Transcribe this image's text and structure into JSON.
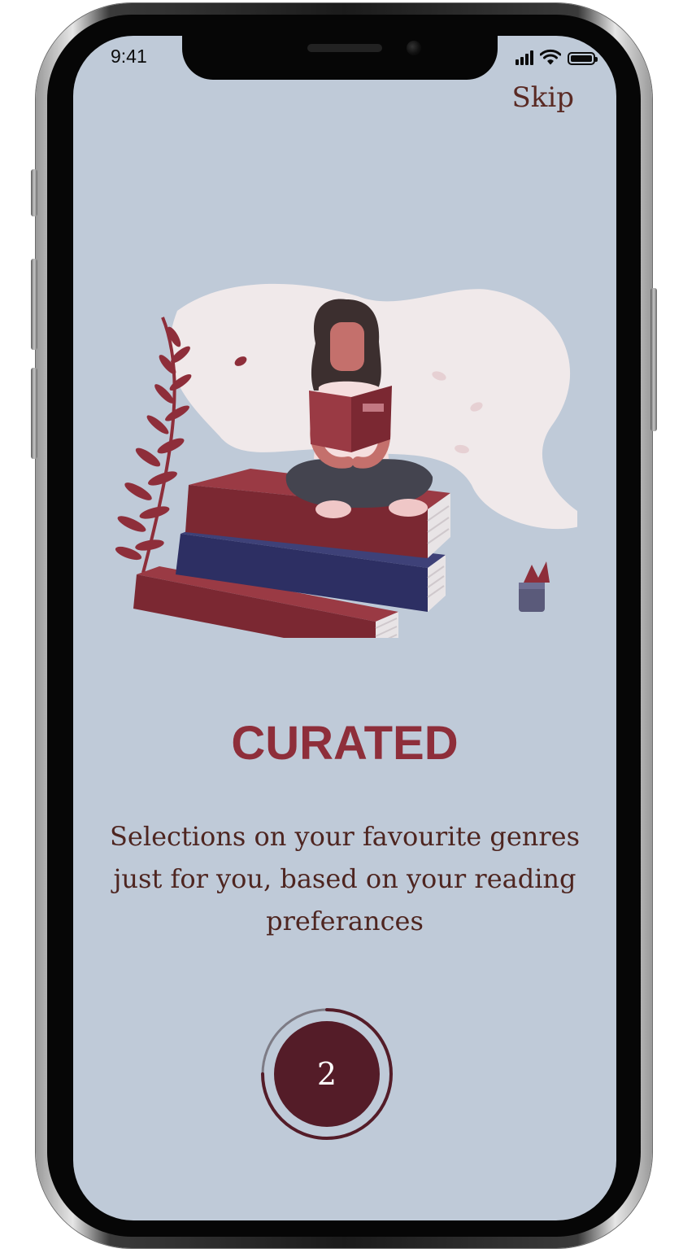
{
  "status_bar": {
    "time": "9:41",
    "icons": [
      "cellular-signal-icon",
      "wifi-icon",
      "battery-icon"
    ]
  },
  "header": {
    "skip_label": "Skip"
  },
  "onboarding": {
    "illustration": "woman-reading-on-book-stack-illustration",
    "title": "CURATED",
    "description": "Selections on your favourite genres just for you, based on your reading preferances",
    "page_number": "2",
    "progress": 0.75
  },
  "colors": {
    "screen_background": "#bfcad8",
    "title": "#8e2e3a",
    "body_text": "#4e2520",
    "indicator_fill": "#541c28",
    "book_red": "#7b2832",
    "book_navy": "#2d2f63"
  }
}
